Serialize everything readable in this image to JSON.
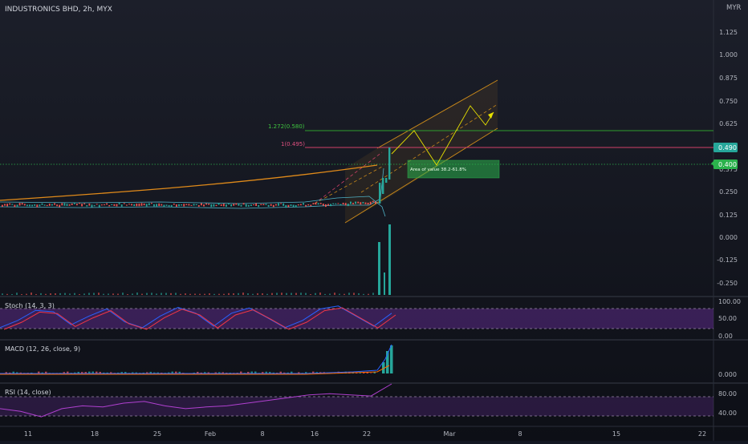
{
  "header": {
    "symbol_title": "INDUSTRONICS BHD, 2h, MYX",
    "currency": "MYR"
  },
  "colors": {
    "background": "#131722",
    "up": "#26a69a",
    "down": "#ef5350",
    "grid": "#1e222d",
    "axis_text": "#b2b5be",
    "fib_green": "#2e9e2e",
    "fib_red": "#d04068",
    "channel": "#f0a020",
    "dotted_level": "#2bb24c",
    "arrow": "#e6e000",
    "stoch_k": "#2962ff",
    "stoch_d": "#f23645",
    "stoch_band": "#5b2a86",
    "macd_line": "#2962ff",
    "signal_line": "#ff6d00",
    "rsi_line": "#9c27b0",
    "price_label_bg": "#26a69a",
    "level_label_bg": "#2bb24c"
  },
  "price_axis": {
    "ticks": [
      "1.125",
      "1.000",
      "0.875",
      "0.750",
      "0.625",
      "0.500",
      "0.375",
      "0.250",
      "0.125",
      "0.000",
      "-0.125",
      "-0.250"
    ],
    "last_price_label": "0.490",
    "level_label": "0.400"
  },
  "annotations": {
    "fib_upper": "1.272(0.580)",
    "fib_lower": "1(0.495)",
    "area_of_value": "Area of value 38.2-61.8%"
  },
  "time_axis": {
    "labels": [
      "11",
      "18",
      "25",
      "Feb",
      "8",
      "16",
      "22",
      "Mar",
      "8",
      "15",
      "22"
    ]
  },
  "panes": {
    "stoch": {
      "title": "Stoch (14, 3, 3)",
      "ticks": [
        "100.00",
        "50.00",
        "0.00"
      ]
    },
    "macd": {
      "title": "MACD (12, 26, close, 9)",
      "ticks": [
        "0.000"
      ]
    },
    "rsi": {
      "title": "RSI (14, close)",
      "ticks": [
        "80.00",
        "40.00"
      ]
    }
  },
  "chart_data": [
    {
      "type": "candlestick",
      "title": "INDUSTRONICS BHD, 2h, MYX",
      "ylim": [
        -0.3,
        1.2
      ],
      "x_labels": [
        "11",
        "18",
        "25",
        "Feb",
        "8",
        "16",
        "22",
        "Mar",
        "8",
        "15",
        "22"
      ],
      "series": [
        {
          "x": [
            "Jan 11",
            "Jan 18",
            "Jan 25",
            "Feb 1",
            "Feb 8",
            "Feb 16",
            "Feb 18",
            "Feb 22",
            "Feb 23",
            "Feb 24",
            "Feb 24"
          ],
          "close": [
            0.18,
            0.18,
            0.175,
            0.18,
            0.18,
            0.185,
            0.2,
            0.195,
            0.26,
            0.32,
            0.49
          ]
        }
      ],
      "levels": [
        {
          "name": "1.272(0.580)",
          "y": 0.58
        },
        {
          "name": "1(0.495)",
          "y": 0.495
        },
        {
          "name": "0.400",
          "y": 0.4
        }
      ],
      "last_price": 0.49
    },
    {
      "type": "line",
      "title": "Stoch (14, 3, 3)",
      "ylim": [
        0,
        100
      ],
      "series": [
        {
          "values": [
            20,
            45,
            80,
            75,
            30,
            60,
            85,
            40,
            20,
            60,
            90,
            70,
            25,
            70,
            88,
            55,
            20,
            45,
            85,
            95,
            60,
            25,
            70
          ]
        }
      ]
    },
    {
      "type": "bar",
      "title": "MACD (12, 26, close, 9)",
      "series": [
        {
          "values": [
            0,
            0,
            0.001,
            0.001,
            0,
            0,
            0,
            0.002,
            0.002,
            0.003,
            0.02,
            0.04,
            0.05
          ]
        }
      ]
    },
    {
      "type": "line",
      "title": "RSI (14, close)",
      "ylim": [
        20,
        90
      ],
      "series": [
        {
          "values": [
            45,
            40,
            30,
            45,
            50,
            48,
            55,
            58,
            50,
            45,
            48,
            50,
            55,
            60,
            65,
            70,
            72,
            70,
            68,
            90
          ]
        }
      ]
    }
  ]
}
